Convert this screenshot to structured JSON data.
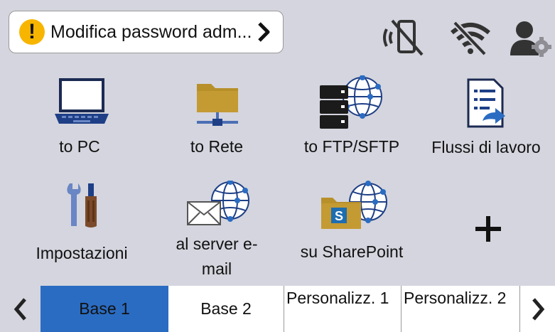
{
  "status_bar": {
    "alert_text": "Modifica password adm...",
    "icons": [
      "warning-icon",
      "chevron-right-icon",
      "nfc-off-icon",
      "wifi-off-icon",
      "user-settings-icon"
    ]
  },
  "apps": [
    {
      "label": "to PC",
      "icon": "laptop-icon"
    },
    {
      "label": "to Rete",
      "icon": "network-folder-icon"
    },
    {
      "label": "to FTP/SFTP",
      "icon": "ftp-server-icon"
    },
    {
      "label": "Flussi di lavoro",
      "icon": "workflow-icon"
    },
    {
      "label": "Impostazioni",
      "icon": "tools-icon"
    },
    {
      "label": "al server e-mail",
      "icon": "email-server-icon"
    },
    {
      "label": "su SharePoint",
      "icon": "sharepoint-icon"
    },
    {
      "label": "",
      "icon": "add-icon"
    }
  ],
  "tabs": [
    {
      "label": "Base 1",
      "active": true
    },
    {
      "label": "Base 2",
      "active": false
    },
    {
      "label": "Personalizz. 1",
      "active": false
    },
    {
      "label": "Personalizz. 2",
      "active": false
    }
  ],
  "colors": {
    "background": "#d4d5de",
    "active_tab": "#2a6cc2",
    "warning": "#f7b500",
    "folder": "#b8902a"
  }
}
